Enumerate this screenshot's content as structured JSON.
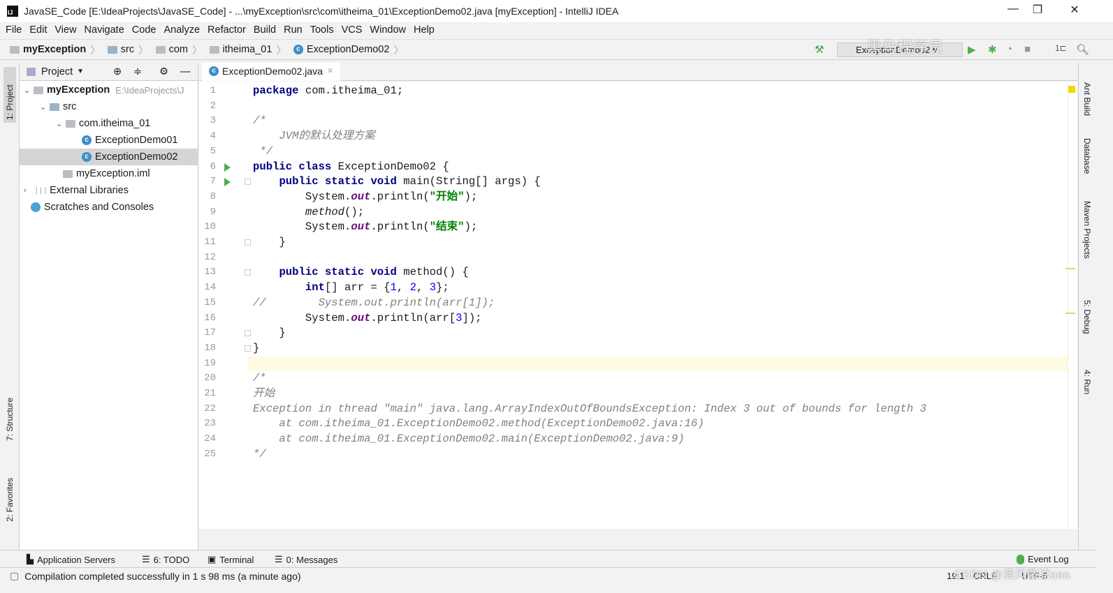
{
  "window": {
    "title": "JavaSE_Code [E:\\IdeaProjects\\JavaSE_Code] - ...\\myException\\src\\com\\itheima_01\\ExceptionDemo02.java [myException] - IntelliJ IDEA",
    "app_icon": "IJ"
  },
  "menu": [
    "File",
    "Edit",
    "View",
    "Navigate",
    "Code",
    "Analyze",
    "Refactor",
    "Build",
    "Run",
    "Tools",
    "VCS",
    "Window",
    "Help"
  ],
  "breadcrumb": [
    "myException",
    "src",
    "com",
    "itheima_01",
    "ExceptionDemo02"
  ],
  "toolbar": {
    "run_config": "ExceptionDemo02"
  },
  "left_strip": {
    "project": "1: Project",
    "structure": "7: Structure",
    "favorites": "2: Favorites"
  },
  "right_strip": [
    "Ant Build",
    "Database",
    "Maven Projects",
    "5: Debug",
    "4: Run"
  ],
  "project_panel": {
    "title": "Project",
    "tree": [
      {
        "label": "myException",
        "hint": "E:\\IdeaProjects\\J",
        "depth": 0,
        "expanded": true,
        "icon": "module-folder",
        "bold": true
      },
      {
        "label": "src",
        "depth": 1,
        "expanded": true,
        "icon": "source-folder"
      },
      {
        "label": "com.itheima_01",
        "depth": 2,
        "expanded": true,
        "icon": "package"
      },
      {
        "label": "ExceptionDemo01",
        "depth": 3,
        "icon": "java-class"
      },
      {
        "label": "ExceptionDemo02",
        "depth": 3,
        "icon": "java-class",
        "selected": true
      },
      {
        "label": "myException.iml",
        "depth": 2,
        "icon": "iml-file"
      },
      {
        "label": "External Libraries",
        "depth": 0,
        "expanded": false,
        "icon": "libraries"
      },
      {
        "label": "Scratches and Consoles",
        "depth": 0,
        "icon": "scratches"
      }
    ]
  },
  "editor": {
    "tab": "ExceptionDemo02.java",
    "current_line": 19,
    "lines": [
      [
        [
          "package",
          "kw"
        ],
        [
          " com.itheima_01;",
          ""
        ]
      ],
      [],
      [
        [
          "/*",
          "cm"
        ]
      ],
      [
        [
          "    JVM的默认处理方案",
          "cm"
        ]
      ],
      [
        [
          " */",
          "cm"
        ]
      ],
      [
        [
          "public class",
          "kw"
        ],
        [
          " ExceptionDemo02 {",
          ""
        ]
      ],
      [
        [
          "    ",
          ""
        ],
        [
          "public static void",
          "kw"
        ],
        [
          " main(String[] args) {",
          ""
        ]
      ],
      [
        [
          "        System.",
          ""
        ],
        [
          "out",
          "fld"
        ],
        [
          ".println(",
          ""
        ],
        [
          "\"开始\"",
          "str"
        ],
        [
          ");",
          ""
        ]
      ],
      [
        [
          "        ",
          ""
        ],
        [
          "method",
          "im"
        ],
        [
          "();",
          ""
        ]
      ],
      [
        [
          "        System.",
          ""
        ],
        [
          "out",
          "fld"
        ],
        [
          ".println(",
          ""
        ],
        [
          "\"结束\"",
          "str"
        ],
        [
          ");",
          ""
        ]
      ],
      [
        [
          "    }",
          ""
        ]
      ],
      [],
      [
        [
          "    ",
          ""
        ],
        [
          "public static void",
          "kw"
        ],
        [
          " method() {",
          ""
        ]
      ],
      [
        [
          "        ",
          ""
        ],
        [
          "int",
          "kw"
        ],
        [
          "[] arr = {",
          ""
        ],
        [
          "1",
          "num"
        ],
        [
          ", ",
          ""
        ],
        [
          "2",
          "num"
        ],
        [
          ", ",
          ""
        ],
        [
          "3",
          "num"
        ],
        [
          "};",
          ""
        ]
      ],
      [
        [
          "//        System.out.println(arr[1]);",
          "cm"
        ]
      ],
      [
        [
          "        System.",
          ""
        ],
        [
          "out",
          "fld"
        ],
        [
          ".println(arr[",
          ""
        ],
        [
          "3",
          "num"
        ],
        [
          "]);",
          ""
        ]
      ],
      [
        [
          "    }",
          ""
        ]
      ],
      [
        [
          "}",
          ""
        ]
      ],
      [],
      [
        [
          "/*",
          "cm"
        ]
      ],
      [
        [
          "开始",
          "cm"
        ]
      ],
      [
        [
          "Exception in thread \"main\" java.lang.ArrayIndexOutOfBoundsException: Index 3 out of bounds for length 3",
          "cm"
        ]
      ],
      [
        [
          "    at com.itheima_01.ExceptionDemo02.method(ExceptionDemo02.java:16)",
          "cm"
        ]
      ],
      [
        [
          "    at com.itheima_01.ExceptionDemo02.main(ExceptionDemo02.java:9)",
          "cm"
        ]
      ],
      [
        [
          "*/",
          "cm"
        ]
      ]
    ],
    "run_lines": [
      6,
      7
    ],
    "fold_lines": [
      7,
      11,
      13,
      17,
      18
    ]
  },
  "bottom_tools": [
    "Application Servers",
    "6: TODO",
    "Terminal",
    "0: Messages"
  ],
  "event_log": "Event Log",
  "status": {
    "message": "Compilation completed successfully in 1 s 98 ms (a minute ago)",
    "position": "19:1",
    "line_sep": "CRLF",
    "encoding": "UTF-8"
  },
  "watermarks": {
    "top": "黑马程序员",
    "bottom": "CSDN @清风微凉aaa"
  },
  "colors": {
    "keyword": "#000080",
    "string": "#008000",
    "comment": "#808080",
    "number": "#0000ff",
    "field": "#660e7a",
    "current_line": "#fffae3",
    "run_marker": "#4caf50"
  }
}
